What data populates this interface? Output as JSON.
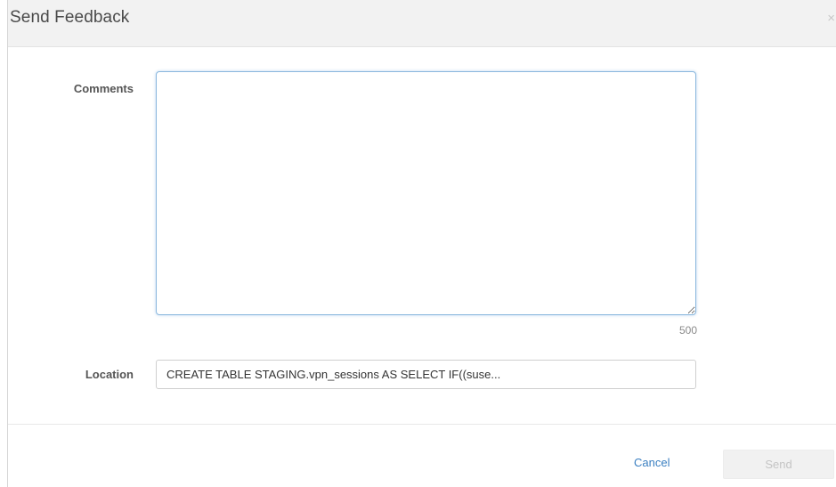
{
  "dialog": {
    "title": "Send Feedback",
    "close_icon": "close-icon",
    "close_glyph": "×"
  },
  "form": {
    "comments_label": "Comments",
    "comments_value": "",
    "char_count": "500",
    "location_label": "Location",
    "location_value": "CREATE TABLE STAGING.vpn_sessions AS SELECT IF((suse..."
  },
  "footer": {
    "cancel_label": "Cancel",
    "send_label": "Send"
  },
  "colors": {
    "link": "#3a7fc1",
    "focus_border": "#8bb8de",
    "header_bg": "#f2f2f2",
    "disabled_button_bg": "#f1f1f1"
  }
}
